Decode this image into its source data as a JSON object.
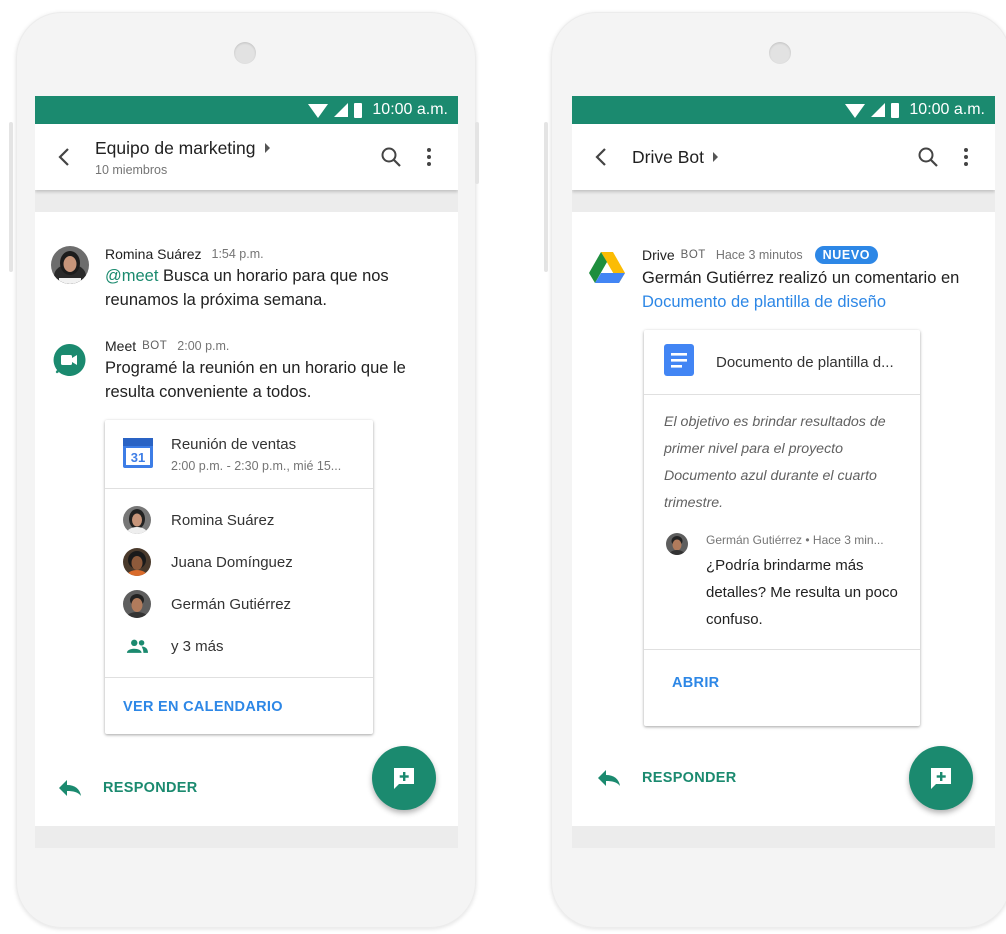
{
  "status": {
    "time": "10:00 a.m."
  },
  "left": {
    "title": "Equipo de marketing",
    "subtitle": "10 miembros",
    "messages": [
      {
        "author": "Romina Suárez",
        "time": "1:54 p.m.",
        "mention": "@meet",
        "text": "Busca un horario para que nos reunamos la próxima semana."
      },
      {
        "author": "Meet",
        "bot_label": "BOT",
        "time": "2:00 p.m.",
        "text": "Programé la reunión en un horario que le resulta conveniente a todos."
      }
    ],
    "event_card": {
      "calendar_day": "31",
      "title": "Reunión de ventas",
      "when": "2:00 p.m. - 2:30 p.m., mié 15...",
      "attendees": [
        "Romina Suárez",
        "Juana Domínguez",
        "Germán Gutiérrez"
      ],
      "more": "y 3 más",
      "action": "VER EN CALENDARIO"
    },
    "reply": "RESPONDER"
  },
  "right": {
    "title": "Drive Bot",
    "message": {
      "author": "Drive",
      "bot_label": "BOT",
      "time": "Hace 3 minutos",
      "badge": "NUEVO",
      "text": "Germán Gutiérrez realizó un comentario en",
      "doc_link": "Documento de plantilla de diseño"
    },
    "doc_card": {
      "doc_title": "Documento de plantilla d...",
      "quote": "El objetivo es brindar resultados de primer nivel para el proyecto Documento azul durante el cuarto trimestre.",
      "comment_meta": "Germán Gutiérrez • Hace 3 min...",
      "comment": "¿Podría brindarme más detalles? Me resulta un poco confuso.",
      "action": "ABRIR"
    },
    "reply": "RESPONDER"
  },
  "colors": {
    "brand_green": "#1b8a6f",
    "link_blue": "#2d87e6"
  },
  "icons": [
    "back-arrow-icon",
    "search-icon",
    "more-vert-icon",
    "reply-icon",
    "new-message-icon",
    "meet-icon",
    "drive-icon",
    "calendar-icon",
    "docs-icon",
    "group-icon"
  ]
}
